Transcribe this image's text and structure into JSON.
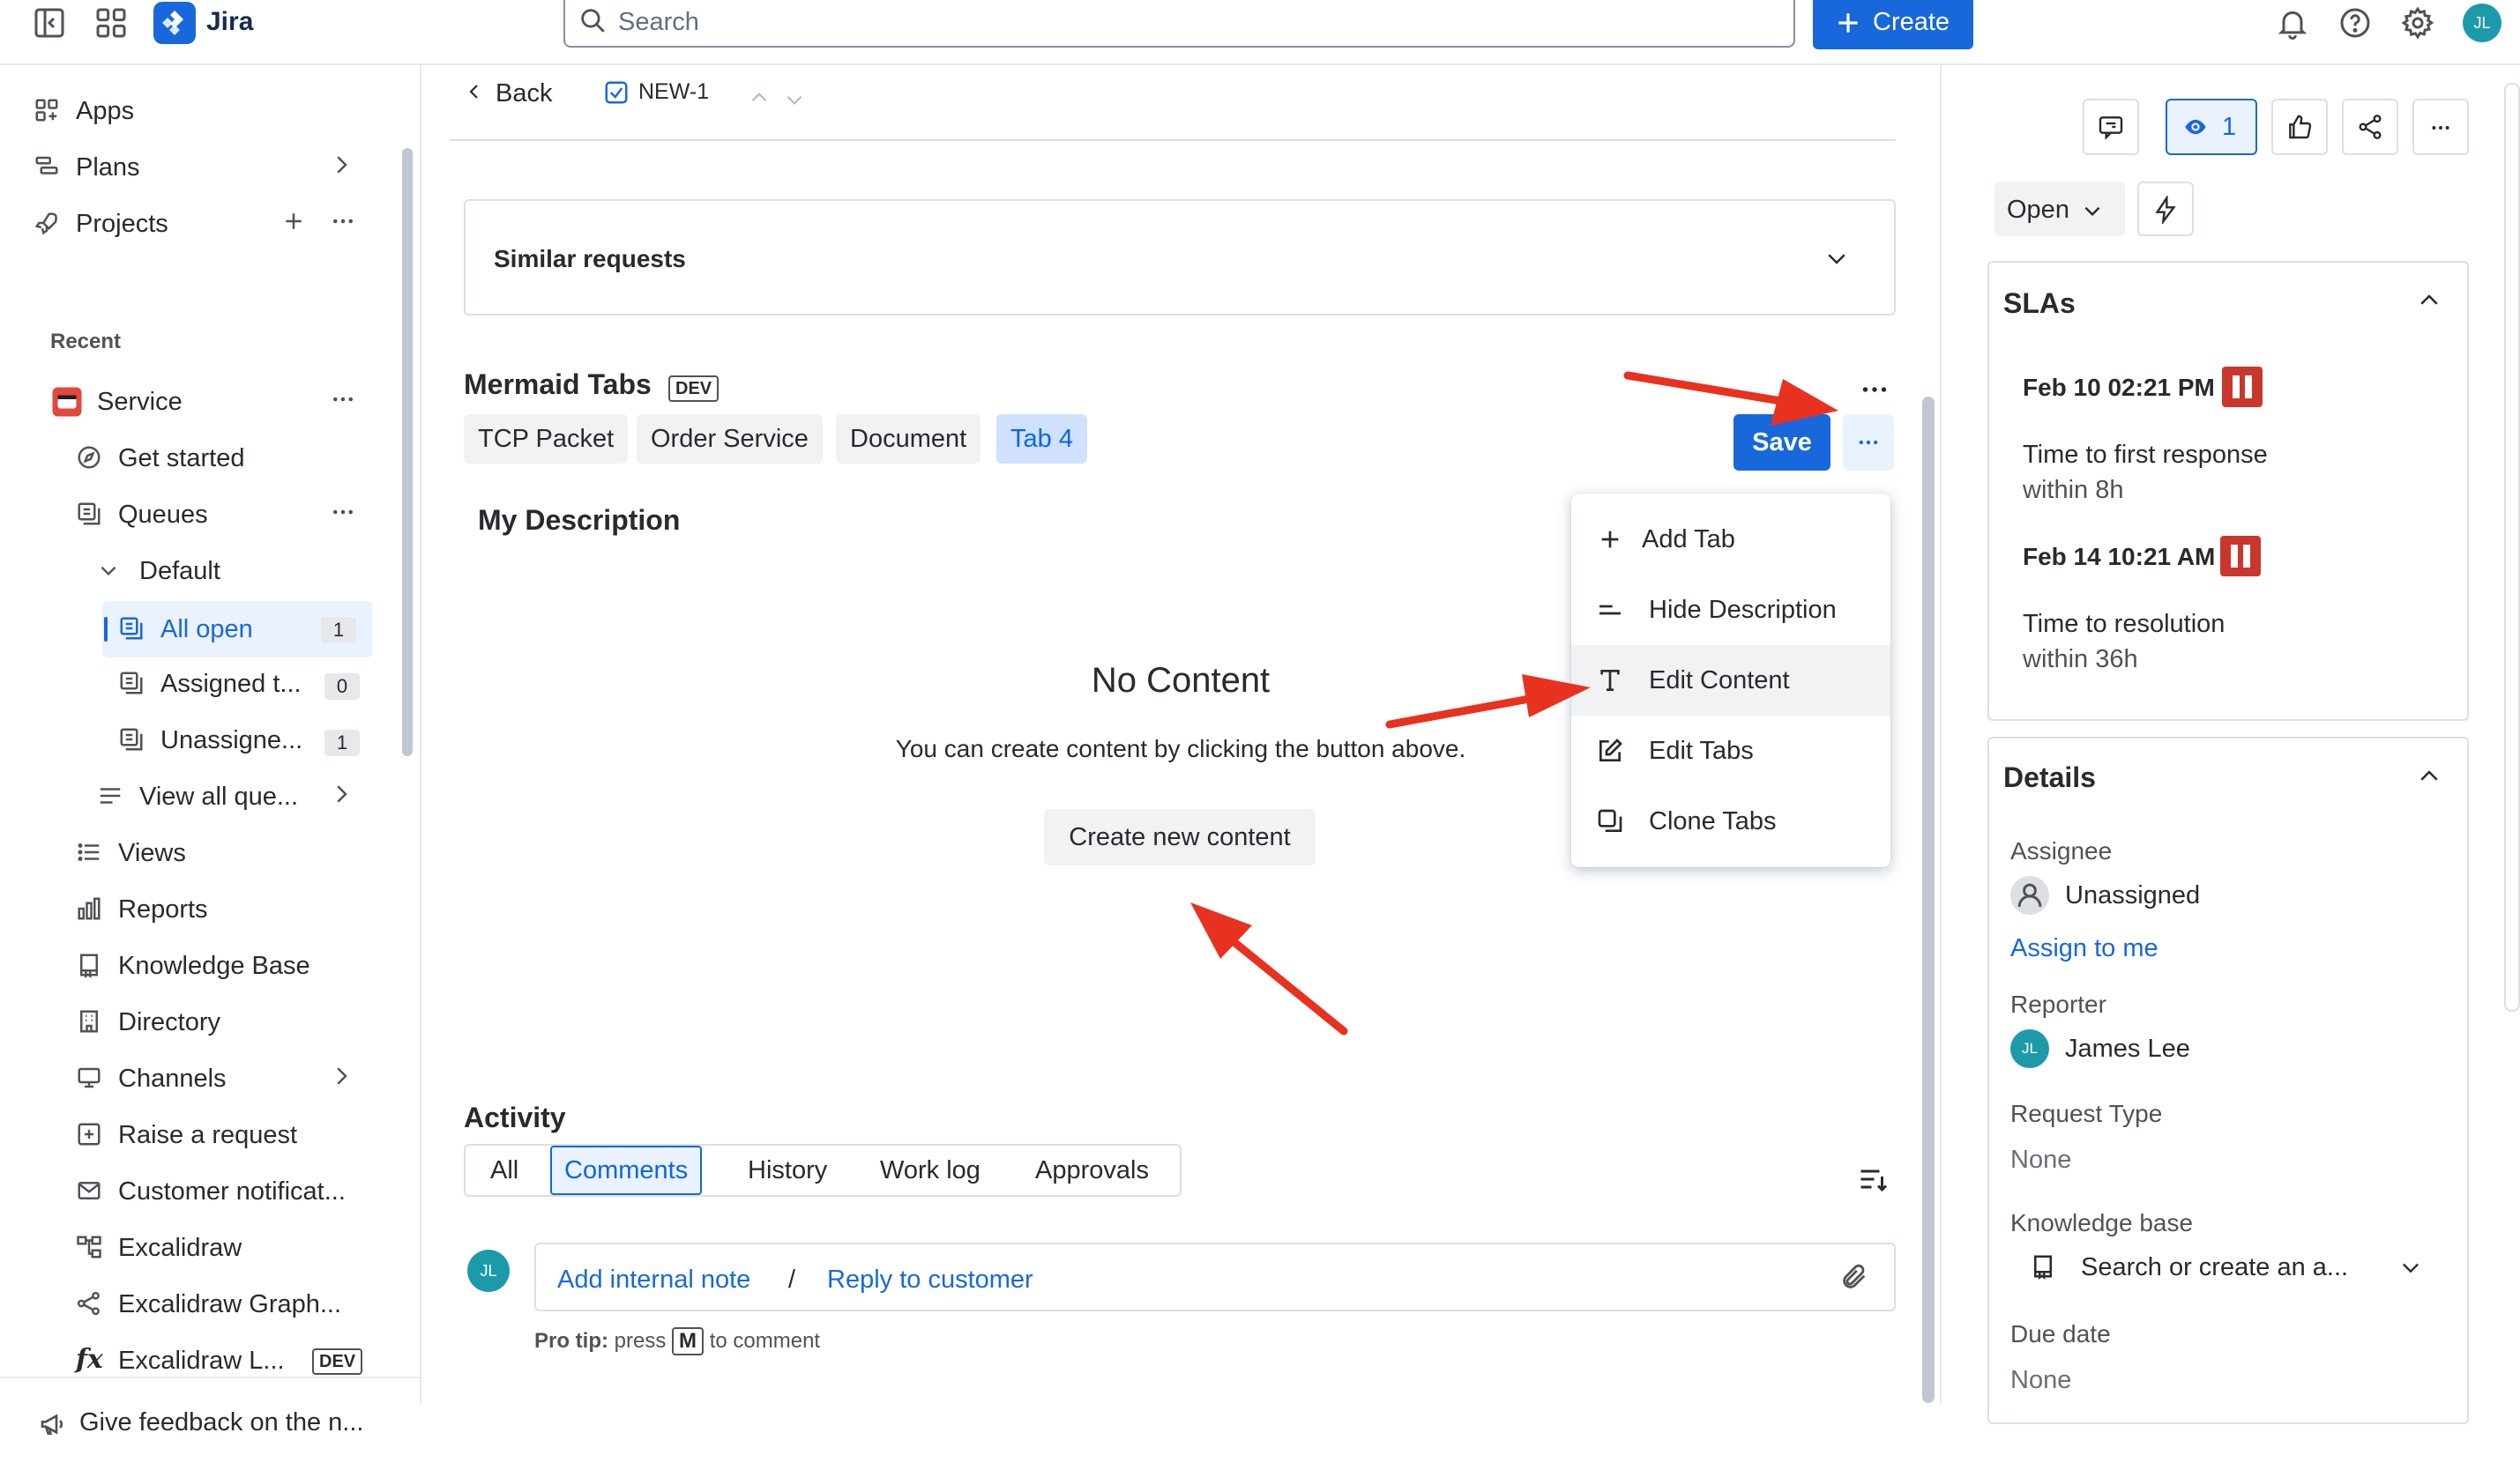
{
  "topbar": {
    "app_name": "Jira",
    "search_placeholder": "Search",
    "create_label": "Create",
    "user_initials": "JL"
  },
  "sidebar": {
    "apps": "Apps",
    "plans": "Plans",
    "projects": "Projects",
    "recent": "Recent",
    "service": "Service",
    "get_started": "Get started",
    "queues": "Queues",
    "default": "Default",
    "all_open": "All open",
    "all_open_count": "1",
    "assigned": "Assigned t...",
    "assigned_count": "0",
    "unassigned": "Unassigne...",
    "unassigned_count": "1",
    "view_all": "View all que...",
    "views": "Views",
    "reports": "Reports",
    "knowledge_base": "Knowledge Base",
    "directory": "Directory",
    "channels": "Channels",
    "raise_request": "Raise a request",
    "customer_notifications": "Customer notificat...",
    "excalidraw": "Excalidraw",
    "excalidraw_graph": "Excalidraw Graph...",
    "excalidraw_l": "Excalidraw L...",
    "dev_badge": "DEV",
    "feedback": "Give feedback on the n..."
  },
  "main": {
    "back": "Back",
    "issue_key": "NEW-1",
    "similar_requests": "Similar requests",
    "mermaid_title": "Mermaid Tabs",
    "mermaid_badge": "DEV",
    "tabs": [
      "TCP Packet",
      "Order Service",
      "Document",
      "Tab 4"
    ],
    "save": "Save",
    "my_description": "My Description",
    "no_content_title": "No Content",
    "no_content_text": "You can create content by clicking the button above.",
    "create_new_content": "Create new content",
    "menu": {
      "add_tab": "Add Tab",
      "hide_description": "Hide Description",
      "edit_content": "Edit Content",
      "edit_tabs": "Edit Tabs",
      "clone_tabs": "Clone Tabs"
    },
    "activity": {
      "title": "Activity",
      "tabs": [
        "All",
        "Comments",
        "History",
        "Work log",
        "Approvals"
      ],
      "add_internal_note": "Add internal note",
      "separator": "/",
      "reply_to_customer": "Reply to customer",
      "pro_tip_bold": "Pro tip:",
      "pro_tip_press": "press",
      "pro_tip_key": "M",
      "pro_tip_rest": "to comment",
      "user_initials": "JL"
    }
  },
  "right": {
    "watch_count": "1",
    "status": "Open",
    "slas_title": "SLAs",
    "sla1_time": "Feb 10 02:21 PM",
    "sla1_name": "Time to first response",
    "sla1_target": "within 8h",
    "sla2_time": "Feb 14 10:21 AM",
    "sla2_name": "Time to resolution",
    "sla2_target": "within 36h",
    "details_title": "Details",
    "assignee_label": "Assignee",
    "assignee_value": "Unassigned",
    "assign_to_me": "Assign to me",
    "reporter_label": "Reporter",
    "reporter_initials": "JL",
    "reporter_value": "James Lee",
    "request_type_label": "Request Type",
    "request_type_value": "None",
    "kb_label": "Knowledge base",
    "kb_value": "Search or create an a...",
    "due_date_label": "Due date",
    "due_date_value": "None"
  },
  "colors": {
    "brand_blue": "#1868db",
    "sla_paused": "#c9372c",
    "annotation_arrow": "#e8321f"
  }
}
